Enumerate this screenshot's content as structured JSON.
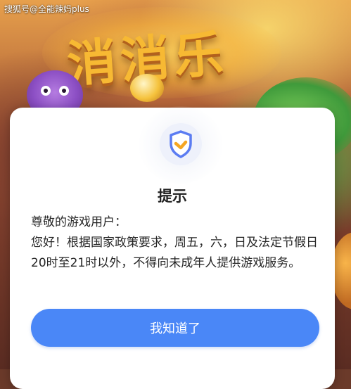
{
  "watermark": {
    "text": "搜狐号@全能辣妈plus"
  },
  "background": {
    "game_title_art": "消消乐"
  },
  "dialog": {
    "icon": "shield-check-icon",
    "title": "提示",
    "greeting": "尊敬的游戏用户：",
    "message": "您好！根据国家政策要求，周五，六，日及法定节假日20时至21时以外，不得向未成年人提供游戏服务。",
    "confirm_label": "我知道了"
  },
  "colors": {
    "button": "#4a87f7",
    "shield_outline": "#5b7cf2",
    "shield_check": "#f5a623"
  }
}
